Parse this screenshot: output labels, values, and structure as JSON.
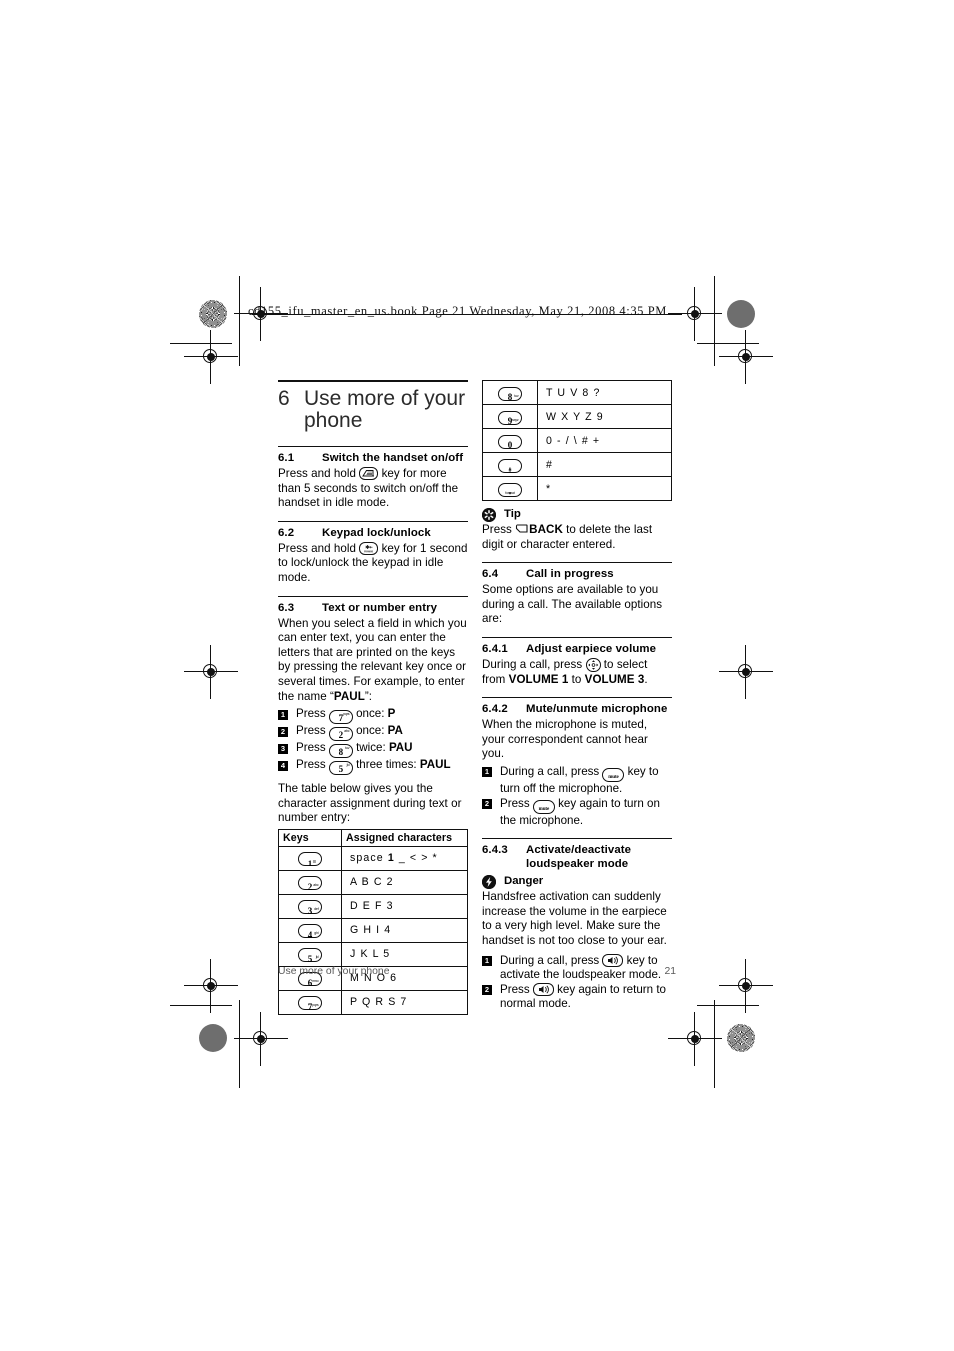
{
  "print_header": {
    "text": "cd155_ifu_master_en_us.book  Page 21  Wednesday, May 21, 2008  4:35 PM"
  },
  "chapter": {
    "number": "6",
    "title": "Use more of your phone"
  },
  "sections": {
    "s61": {
      "number": "6.1",
      "title": "Switch the handset on/off",
      "body_a": "Press and hold ",
      "body_b": " key for more than 5 seconds to switch on/off the handset in idle mode."
    },
    "s62": {
      "number": "6.2",
      "title": "Keypad lock/unlock",
      "body_a": "Press and hold ",
      "body_b": " key for 1 second to lock/unlock the keypad in idle mode."
    },
    "s63": {
      "number": "6.3",
      "title": "Text or number entry",
      "body": "When you select a field in which you can enter text, you can enter the letters that are printed on the keys by pressing the relevant key once or several times. For example, to enter the name “PAUL”:",
      "body_pre": "When you select a field in which you can enter text, you can enter the letters that are printed on the keys by pressing the relevant key once or several times. For example, to enter the name “",
      "body_bold": "PAUL",
      "body_post": "”:",
      "steps": [
        {
          "marker": "1",
          "pre": "Press ",
          "key_digit": "7",
          "key_sub": "pqrs",
          "mid": " once: ",
          "result": "P"
        },
        {
          "marker": "2",
          "pre": "Press ",
          "key_digit": "2",
          "key_sub": "abc",
          "mid": " once: ",
          "result": "PA"
        },
        {
          "marker": "3",
          "pre": "Press ",
          "key_digit": "8",
          "key_sub": "tuv",
          "mid": " twice: ",
          "result": "PAU"
        },
        {
          "marker": "4",
          "pre": "Press ",
          "key_digit": "5",
          "key_sub": "jkl",
          "mid": " three times: ",
          "result": "PAUL"
        }
      ],
      "table_intro": "The table below gives you the character assignment during text or number entry:"
    },
    "tip": {
      "icon": "tip-asterisk-icon",
      "label": "Tip",
      "body_a": "Press ",
      "body_bold": "BACK",
      "body_b": " to delete the last digit or character entered."
    },
    "s64": {
      "number": "6.4",
      "title": "Call in progress",
      "body": "Some options are available to you during a call. The available options are:"
    },
    "s641": {
      "number": "6.4.1",
      "title": "Adjust earpiece volume",
      "body_a": "During a call, press ",
      "body_b": " to select from ",
      "vol_from": "VOLUME 1",
      "body_c": " to ",
      "vol_to": "VOLUME 3",
      "body_d": "."
    },
    "s642": {
      "number": "6.4.2",
      "title": "Mute/unmute microphone",
      "body": "When the microphone is muted, your correspondent cannot hear you.",
      "steps": [
        {
          "marker": "1",
          "pre": "During a call, press ",
          "key_label": "mute",
          "post": " key to turn off the microphone."
        },
        {
          "marker": "2",
          "pre": "Press ",
          "key_label": "mute",
          "post": " key again to turn on the microphone."
        }
      ]
    },
    "s643": {
      "number": "6.4.3",
      "title_line1": "Activate/deactivate",
      "title_line2": "loudspeaker mode",
      "danger": {
        "icon": "danger-bolt-icon",
        "label": "Danger",
        "body": "Handsfree activation can suddenly increase the volume in the earpiece to a very high level. Make sure the handset is not too close to your ear."
      },
      "steps": [
        {
          "marker": "1",
          "pre": "During a call, press ",
          "key_label": "loudspeaker",
          "post": " key to activate the loudspeaker mode."
        },
        {
          "marker": "2",
          "pre": "Press ",
          "key_label": "loudspeaker",
          "post": " key again to return to normal mode."
        }
      ]
    }
  },
  "key_table": {
    "headers": [
      "Keys",
      "Assigned characters"
    ],
    "rows_left": [
      {
        "digit": "1",
        "sub": "",
        "stacked": true,
        "chars": "space 1 _ < > *",
        "chars_pre": "space ",
        "chars_bold": "1",
        "chars_post": " _ < > *"
      },
      {
        "digit": "2",
        "sub": "abc",
        "chars": "A B C 2"
      },
      {
        "digit": "3",
        "sub": "def",
        "chars": "D E F 3"
      },
      {
        "digit": "4",
        "sub": "ghi",
        "chars": "G H I 4"
      },
      {
        "digit": "5",
        "sub": "jkl",
        "chars": "J K L 5"
      },
      {
        "digit": "6",
        "sub": "mno",
        "chars": "M N O 6"
      },
      {
        "digit": "7",
        "sub": "pqrs",
        "chars": "P Q R S 7"
      }
    ],
    "rows_right": [
      {
        "digit": "8",
        "sub": "tuv",
        "chars": "T U V 8 ?"
      },
      {
        "digit": "9",
        "sub": "wxyz",
        "chars": "W X Y Z 9"
      },
      {
        "digit": "0",
        "sub": "",
        "chars": "0 - / \\ # +"
      },
      {
        "digit": "#",
        "sub": "",
        "sub2": "$",
        "chars": "#"
      },
      {
        "digit": "*",
        "sub": "",
        "sub2": "format",
        "chars": "*"
      }
    ]
  },
  "footer": {
    "left": "Use more of your phone",
    "page": "21"
  }
}
